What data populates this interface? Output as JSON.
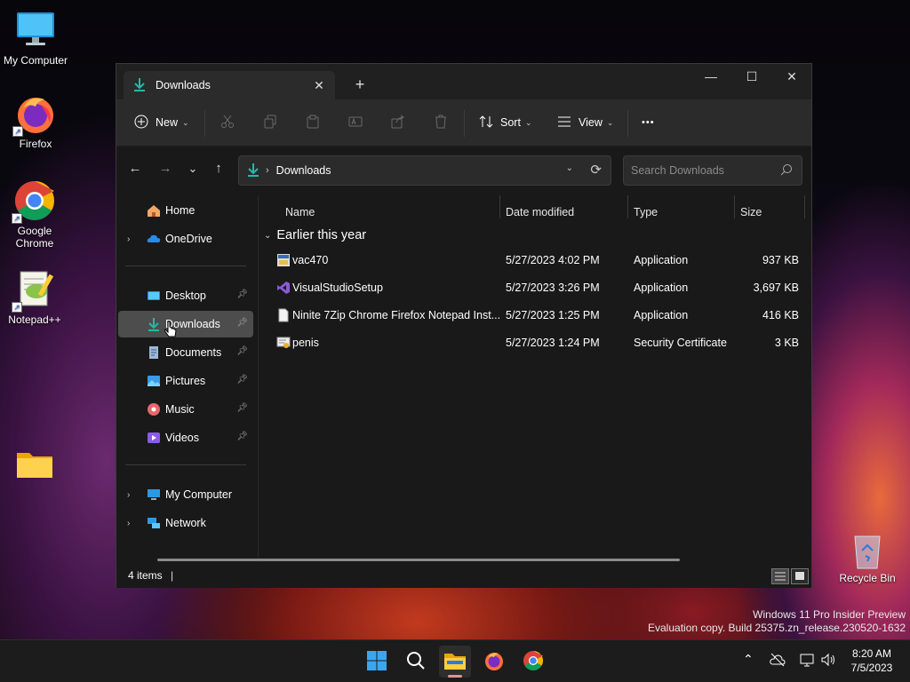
{
  "desktop": {
    "icons": [
      {
        "label": "My Computer",
        "icon": "monitor-icon"
      },
      {
        "label": "Firefox",
        "icon": "firefox-icon"
      },
      {
        "label": "Google Chrome",
        "icon": "chrome-icon"
      },
      {
        "label": "Notepad++",
        "icon": "notepadpp-icon"
      },
      {
        "label": "",
        "icon": "folder-icon"
      }
    ],
    "recycle_bin": "Recycle Bin",
    "watermark_line1": "Windows 11 Pro Insider Preview",
    "watermark_line2": "Evaluation copy. Build 25375.zn_release.230520-1632"
  },
  "window": {
    "tab_title": "Downloads",
    "tab_close": "✕",
    "new_tab": "+",
    "controls": {
      "minimize": "—",
      "maximize": "☐",
      "close": "✕"
    },
    "toolbar": {
      "new_label": "New",
      "sort_label": "Sort",
      "view_label": "View",
      "more": "•••"
    },
    "address": {
      "crumb": "Downloads",
      "separator": "›"
    },
    "search": {
      "placeholder": "Search Downloads"
    },
    "nav": {
      "back": "←",
      "forward": "→",
      "recent": "⌄",
      "up": "↑"
    },
    "sidebar": {
      "home": "Home",
      "onedrive": "OneDrive",
      "quick": [
        {
          "label": "Desktop",
          "icon": "desktop-folder-icon"
        },
        {
          "label": "Downloads",
          "icon": "downloads-icon"
        },
        {
          "label": "Documents",
          "icon": "documents-icon"
        },
        {
          "label": "Pictures",
          "icon": "pictures-icon"
        },
        {
          "label": "Music",
          "icon": "music-icon"
        },
        {
          "label": "Videos",
          "icon": "videos-icon"
        }
      ],
      "my_computer": "My Computer",
      "network": "Network",
      "selected": "Downloads"
    },
    "columns": {
      "name": "Name",
      "date": "Date modified",
      "type": "Type",
      "size": "Size"
    },
    "group": "Earlier this year",
    "files": [
      {
        "name": "vac470",
        "date": "5/27/2023 4:02 PM",
        "type": "Application",
        "size": "937 KB",
        "icon": "app-installer-icon"
      },
      {
        "name": "VisualStudioSetup",
        "date": "5/27/2023 3:26 PM",
        "type": "Application",
        "size": "3,697 KB",
        "icon": "visual-studio-icon"
      },
      {
        "name": "Ninite 7Zip Chrome Firefox Notepad Inst...",
        "date": "5/27/2023 1:25 PM",
        "type": "Application",
        "size": "416 KB",
        "icon": "blank-file-icon"
      },
      {
        "name": "penis",
        "date": "5/27/2023 1:24 PM",
        "type": "Security Certificate",
        "size": "3 KB",
        "icon": "certificate-icon"
      }
    ],
    "status": {
      "count": "4 items",
      "bar": "|"
    }
  },
  "taskbar": {
    "apps": [
      "start-icon",
      "search-icon",
      "file-explorer-icon",
      "firefox-icon",
      "chrome-icon"
    ],
    "active": "file-explorer-icon",
    "tray": {
      "chevron": "⌃"
    },
    "time": "8:20 AM",
    "date": "7/5/2023"
  }
}
